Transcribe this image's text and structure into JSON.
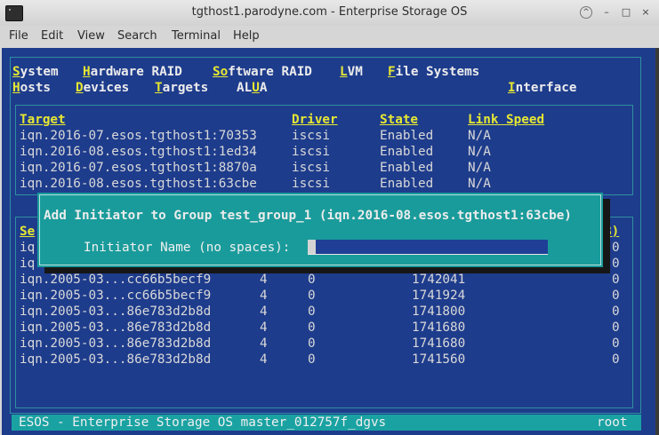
{
  "window": {
    "title": "tgthost1.parodyne.com - Enterprise Storage OS",
    "buttons": {
      "up": "^",
      "minimize": "–",
      "maximize": "□",
      "close": "×"
    }
  },
  "menubar": [
    "File",
    "Edit",
    "View",
    "Search",
    "Terminal",
    "Help"
  ],
  "esos_menu": {
    "row1": [
      {
        "hot": "S",
        "rest": "ystem"
      },
      {
        "pre": "H",
        "rest": "ardware RAID"
      },
      {
        "pre": "So",
        "hot": "f",
        "rest": "tware RAID"
      },
      {
        "hot": "L",
        "rest": "VM"
      },
      {
        "hot": "F",
        "rest": "ile Systems"
      }
    ],
    "row2": [
      {
        "hot": "H",
        "rest": "osts"
      },
      {
        "hot": "D",
        "rest": "evices"
      },
      {
        "hot": "T",
        "rest": "argets"
      },
      {
        "pre": "AL",
        "hot": "U",
        "rest": "A"
      },
      {
        "hot": "I",
        "rest": "nterface"
      }
    ]
  },
  "targets_table": {
    "headers": [
      "Target",
      "Driver",
      "State",
      "Link Speed"
    ],
    "rows": [
      [
        "iqn.2016-07.esos.tgthost1:70353",
        "iscsi",
        "Enabled",
        "N/A"
      ],
      [
        "iqn.2016-08.esos.tgthost1:1ed34",
        "iscsi",
        "Enabled",
        "N/A"
      ],
      [
        "iqn.2016-07.esos.tgthost1:8870a",
        "iscsi",
        "Enabled",
        "N/A"
      ],
      [
        "iqn.2016-08.esos.tgthost1:63cbe",
        "iscsi",
        "Enabled",
        "N/A"
      ]
    ]
  },
  "sessions_table": {
    "header_left": "Se",
    "header_right": "B)",
    "partial_rows": [
      {
        "left": "iq",
        "right": "0"
      },
      {
        "left": "iq",
        "right": "0"
      }
    ],
    "rows": [
      [
        "iqn.2005-03...cc66b5becf9",
        "4",
        "0",
        "1742041",
        "0"
      ],
      [
        "iqn.2005-03...cc66b5becf9",
        "4",
        "0",
        "1741924",
        "0"
      ],
      [
        "iqn.2005-03...86e783d2b8d",
        "4",
        "0",
        "1741800",
        "0"
      ],
      [
        "iqn.2005-03...86e783d2b8d",
        "4",
        "0",
        "1741680",
        "0"
      ],
      [
        "iqn.2005-03...86e783d2b8d",
        "4",
        "0",
        "1741680",
        "0"
      ],
      [
        "iqn.2005-03...86e783d2b8d",
        "4",
        "0",
        "1741560",
        "0"
      ]
    ]
  },
  "dialog": {
    "title": "Add Initiator to Group test_group_1 (iqn.2016-08.esos.tgthost1:63cbe)",
    "label": "Initiator Name (no spaces):",
    "value": ""
  },
  "status": {
    "left": "ESOS - Enterprise Storage OS master_012757f_dgvs",
    "right": "root"
  }
}
